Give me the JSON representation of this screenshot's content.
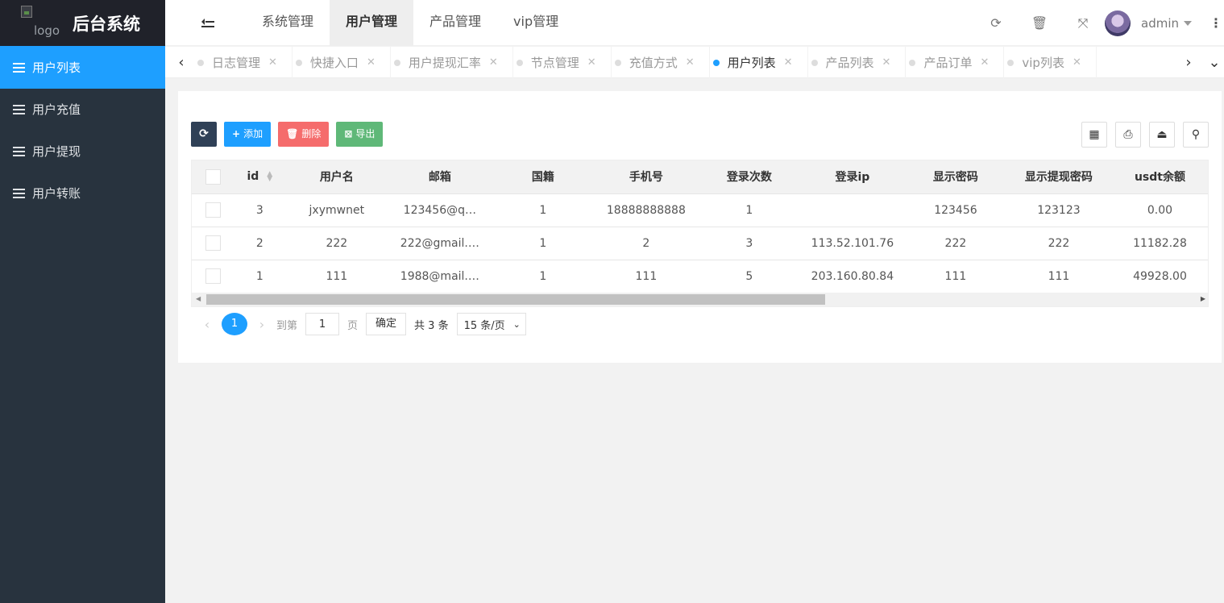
{
  "brand": {
    "logo_alt": "logo",
    "title": "后台系统"
  },
  "sidebar": {
    "items": [
      {
        "label": "用户列表",
        "active": true
      },
      {
        "label": "用户充值"
      },
      {
        "label": "用户提现"
      },
      {
        "label": "用户转账"
      }
    ]
  },
  "header": {
    "nav": [
      "系统管理",
      "用户管理",
      "产品管理",
      "vip管理"
    ],
    "active_nav": "用户管理",
    "username": "admin"
  },
  "tabs": {
    "items": [
      "日志管理",
      "快捷入口",
      "用户提现汇率",
      "节点管理",
      "充值方式",
      "用户列表",
      "产品列表",
      "产品订单",
      "vip列表"
    ],
    "active": "用户列表"
  },
  "toolbar": {
    "add": "添加",
    "delete": "删除",
    "export": "导出"
  },
  "table": {
    "columns": [
      "id",
      "用户名",
      "邮箱",
      "国籍",
      "手机号",
      "登录次数",
      "登录ip",
      "显示密码",
      "显示提现密码",
      "usdt余额"
    ],
    "rows": [
      [
        "3",
        "jxymwnet",
        "123456@q…",
        "1",
        "18888888888",
        "1",
        "",
        "123456",
        "123123",
        "0.00"
      ],
      [
        "2",
        "222",
        "222@gmail.…",
        "1",
        "2",
        "3",
        "113.52.101.76",
        "222",
        "222",
        "11182.28"
      ],
      [
        "1",
        "111",
        "1988@mail.…",
        "1",
        "111",
        "5",
        "203.160.80.84",
        "111",
        "111",
        "49928.00"
      ]
    ]
  },
  "pager": {
    "current": "1",
    "goto_label": "到第",
    "goto_value": "1",
    "page_unit": "页",
    "confirm": "确定",
    "total": "共 3 条",
    "page_size": "15 条/页"
  },
  "colors": {
    "accent": "#1e9fff",
    "sidebar": "#28333e",
    "logo_bg": "#20222a",
    "delete": "#f56c6c",
    "export": "#5fb878",
    "refresh": "#2f4056"
  }
}
